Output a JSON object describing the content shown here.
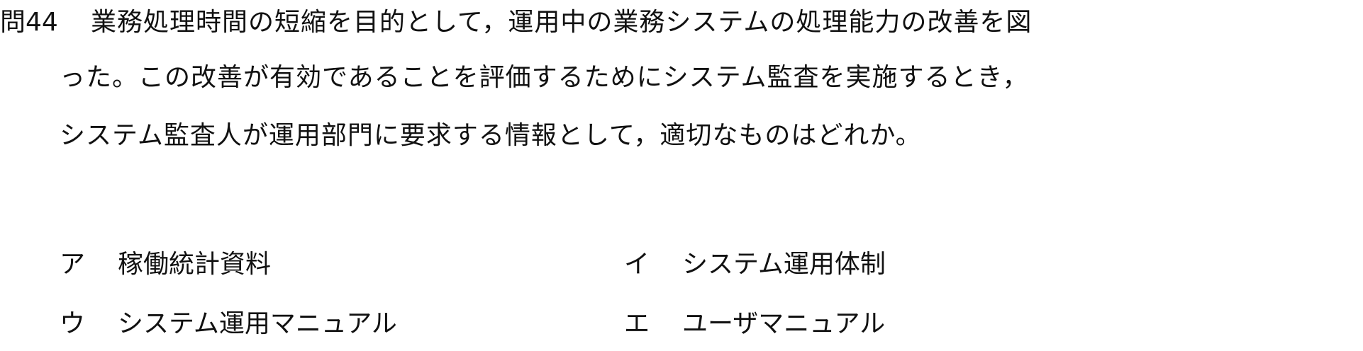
{
  "question": {
    "number": "問44",
    "lines": [
      "業務処理時間の短縮を目的として，運用中の業務システムの処理能力の改善を図",
      "った。この改善が有効であることを評価するためにシステム監査を実施するとき，",
      "システム監査人が運用部門に要求する情報として，適切なものはどれか。"
    ]
  },
  "choices": [
    {
      "label": "ア",
      "text": "稼働統計資料"
    },
    {
      "label": "イ",
      "text": "システム運用体制"
    },
    {
      "label": "ウ",
      "text": "システム運用マニュアル"
    },
    {
      "label": "エ",
      "text": "ユーザマニュアル"
    }
  ]
}
